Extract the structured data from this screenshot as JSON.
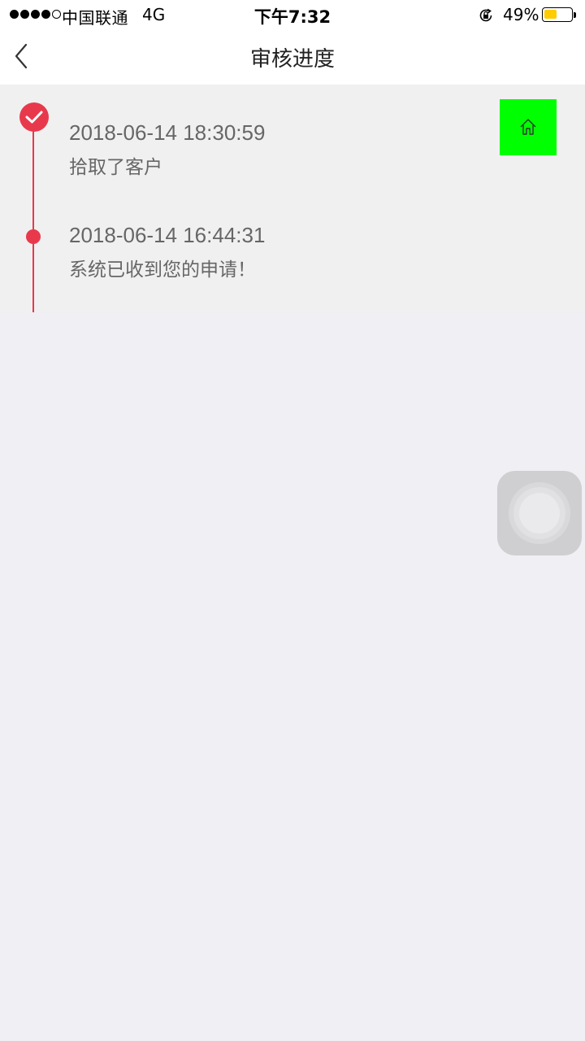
{
  "status_bar": {
    "carrier": "中国联通",
    "network": "4G",
    "time": "下午7:32",
    "battery_percent": "49%",
    "battery_level": 0.49,
    "signal_strength": 4,
    "signal_max": 5,
    "battery_color": "#ffcc00",
    "lock_icon": "rotation-lock-icon"
  },
  "nav": {
    "title": "审核进度",
    "back_icon": "chevron-left-icon"
  },
  "timeline": {
    "accent_color": "#e8394c",
    "entries": [
      {
        "time": "2018-06-14 18:30:59",
        "description": "拾取了客户",
        "marker": "check-icon"
      },
      {
        "time": "2018-06-14 16:44:31",
        "description": "系统已收到您的申请！",
        "marker": "dot"
      }
    ]
  },
  "home_button": {
    "icon": "home-icon",
    "color": "#00ff00"
  },
  "assistive_touch": {
    "icon": "assistive-touch-icon"
  }
}
